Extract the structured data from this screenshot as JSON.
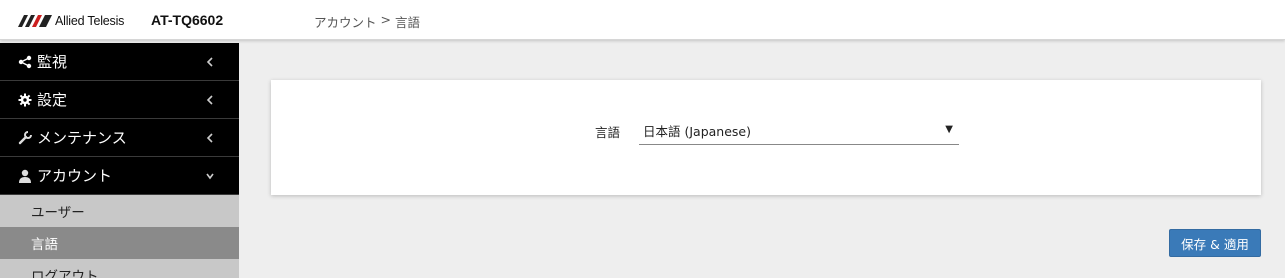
{
  "header": {
    "brand": "Allied Telesis",
    "model": "AT-TQ6602",
    "breadcrumb": {
      "parent": "アカウント",
      "separator": ">",
      "current": "言語"
    }
  },
  "sidebar": {
    "items": [
      {
        "label": "監視",
        "icon": "share-icon",
        "expanded": false
      },
      {
        "label": "設定",
        "icon": "gear-icon",
        "expanded": false
      },
      {
        "label": "メンテナンス",
        "icon": "wrench-icon",
        "expanded": false
      },
      {
        "label": "アカウント",
        "icon": "user-icon",
        "expanded": true
      }
    ],
    "subitems": [
      {
        "label": "ユーザー",
        "active": false
      },
      {
        "label": "言語",
        "active": true
      },
      {
        "label": "ログアウト",
        "active": false
      }
    ]
  },
  "main": {
    "language_label": "言語",
    "language_value": "日本語 (Japanese)",
    "save_label": "保存 & 適用"
  },
  "colors": {
    "sidebar_bg": "#000000",
    "subitem_bg": "#c8c8c8",
    "subitem_active_bg": "#8a8a8a",
    "button_bg": "#3a7ab8"
  }
}
